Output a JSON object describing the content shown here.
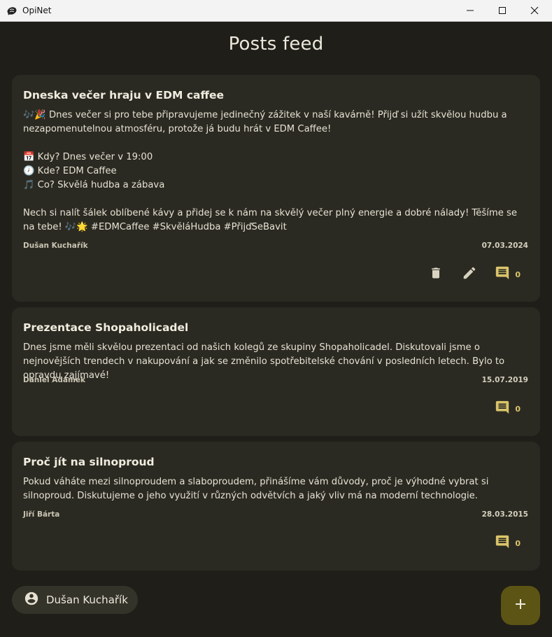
{
  "window": {
    "title": "OpiNet",
    "controls": {
      "minimize_icon": "minimize-icon",
      "maximize_icon": "maximize-icon",
      "close_icon": "close-icon"
    }
  },
  "page": {
    "title": "Posts feed"
  },
  "posts": [
    {
      "title": "Dneska večer hraju v EDM caffee",
      "body": "🎶🎉 Dnes večer si pro tebe připravujeme jedinečný zážitek v naší kavárně! Přijď si užít skvělou hudbu a nezapomenutelnou atmosféru, protože já budu hrát v EDM Caffee!\n\n📅 Kdy? Dnes večer v 19:00\n🕖 Kde? EDM Caffee\n🎵 Co? Skvělá hudba a zábava\n\nNech si nalít šálek oblíbené kávy a přidej se k nám na skvělý večer plný energie a dobré nálady! Těšíme se na tebe! 🎶🌟 #EDMCaffee #SkvěláHudba #PřijďSeBavit",
      "author": "Dušan Kuchařík",
      "date": "07.03.2024",
      "comments": "0",
      "actions": [
        "delete-icon",
        "edit-icon",
        "comment-icon"
      ]
    },
    {
      "title": "Prezentace Shopaholicadel",
      "body": "Dnes jsme měli skvělou prezentaci od našich kolegů ze skupiny Shopaholicadel. Diskutovali jsme o nejnovějších trendech v nakupování a jak se změnilo spotřebitelské chování v posledních letech. Bylo to opravdu zajímavé!",
      "author": "Daniel Adámek",
      "date": "15.07.2019",
      "comments": "0",
      "actions": [
        "comment-icon"
      ]
    },
    {
      "title": "Proč jít na silnoproud",
      "body": "Pokud váháte mezi silnoproudem a slaboproudem, přinášíme vám důvody, proč je výhodné vybrat si silnoproud. Diskutujeme o jeho využití v různých odvětvích a jaký vliv má na moderní technologie.",
      "author": "Jiří Bárta",
      "date": "28.03.2015",
      "comments": "0",
      "actions": [
        "comment-icon"
      ]
    }
  ],
  "current_user": {
    "name": "Dušan Kuchařík",
    "icon": "account-circle-icon"
  },
  "fab": {
    "icon": "plus-icon"
  },
  "colors": {
    "background": "#1f1e18",
    "card": "#2b2a22",
    "accent": "#d9c46a",
    "fab": "#5c5414",
    "icon_muted": "#d8d2c0"
  }
}
